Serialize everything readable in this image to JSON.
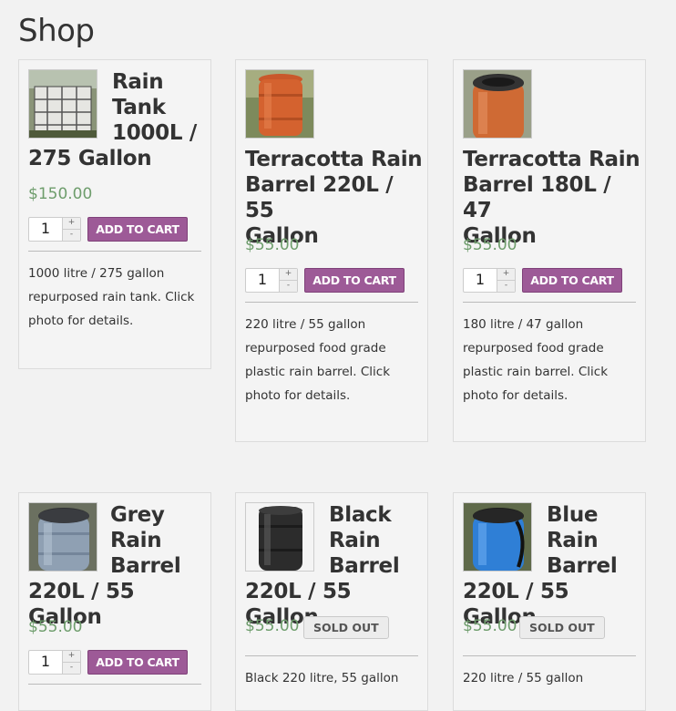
{
  "page_title": "Shop",
  "products": [
    {
      "name": "Rain Tank 1000L / 275 Gallon",
      "price": "$150.00",
      "qty": "1",
      "action": "ADD TO CART",
      "description": "1000 litre / 275 gallon repurposed rain tank. Click photo for details.",
      "image": "rain-tank-photo"
    },
    {
      "name": "Terracotta Rain Barrel 220L / 55 Gallon",
      "price": "$55.00",
      "qty": "1",
      "action": "ADD TO CART",
      "description": "220 litre / 55 gallon repurposed food grade plastic rain barrel. Click photo for details.",
      "image": "terracotta-barrel-photo"
    },
    {
      "name": "Terracotta Rain Barrel 180L / 47 Gallon",
      "price": "$55.00",
      "qty": "1",
      "action": "ADD TO CART",
      "description": "180 litre / 47 gallon repurposed food grade plastic rain barrel. Click photo for details.",
      "image": "terracotta-barrel-small-photo"
    },
    {
      "name": "Grey Rain Barrel 220L / 55 Gallon",
      "price": "$55.00",
      "qty": "1",
      "action": "ADD TO CART",
      "description": "",
      "image": "grey-barrel-photo"
    },
    {
      "name": "Black Rain Barrel 220L / 55 Gallon",
      "price": "$55.00",
      "action": "SOLD OUT",
      "description": "Black 220 litre, 55 gallon",
      "image": "black-barrel-photo"
    },
    {
      "name": "Blue Rain Barrel 220L / 55 Gallon",
      "price": "$55.00",
      "action": "SOLD OUT",
      "description": "220 litre / 55 gallon",
      "image": "blue-barrel-photo"
    }
  ],
  "qty_up": "+",
  "qty_down": "-"
}
